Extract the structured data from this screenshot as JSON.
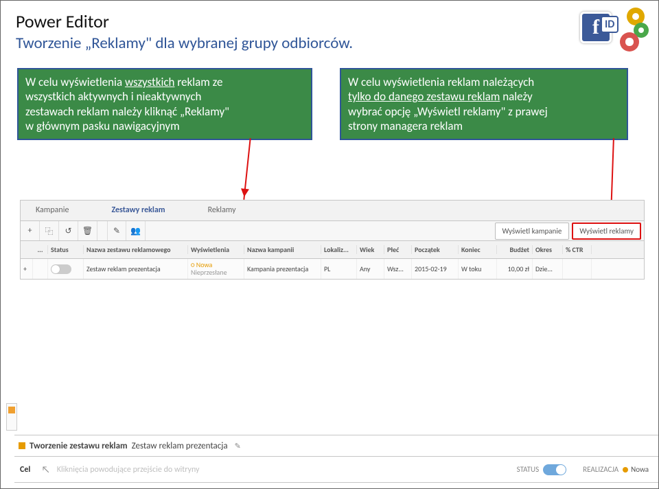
{
  "title": {
    "main": "Power Editor",
    "sub": "Tworzenie „Reklamy\" dla wybranej grupy odbiorców."
  },
  "callouts": {
    "left": {
      "line1a": "W celu wyświetlenia ",
      "line1b_underline": "wszystkich",
      "line1c": " reklam ze",
      "line2": "wszystkich aktywnych i nieaktywnych",
      "line3": "zestawach reklam należy kliknąć „Reklamy\"",
      "line4": "w głównym pasku nawigacyjnym"
    },
    "right": {
      "line1": "W celu wyświetlenia reklam należących",
      "line2a_underline": "tylko do danego zestawu reklam",
      "line2b": " należy",
      "line3": "wybrać opcję „Wyświetl reklamy\" z prawej",
      "line4": "strony managera reklam"
    }
  },
  "tabs": {
    "kampanie": "Kampanie",
    "zestawy": "Zestawy reklam",
    "reklamy": "Reklamy"
  },
  "right_buttons": {
    "campaigns": "Wyświetl kampanie",
    "ads": "Wyświetl reklamy"
  },
  "toolbar": {
    "add": "+",
    "dup": "⿻",
    "rev": "↺",
    "del": "🗑",
    "edit": "✎",
    "multi": "👥"
  },
  "headers": {
    "etc": "...",
    "status": "Status",
    "name": "Nazwa zestawu reklamowego",
    "wysw": "Wyświetlenia",
    "kamp": "Nazwa kampanii",
    "lok": "Lokaliz...",
    "wiek": "Wiek",
    "plec": "Płeć",
    "pocz": "Początek",
    "kon": "Koniec",
    "budz": "Budżet",
    "okres": "Okres",
    "ctr": "% CTR"
  },
  "row": {
    "expand": "+",
    "name": "Zestaw reklam prezentacja",
    "wysw_top": "○ Nowa",
    "wysw_sub": "Nieprzesłane",
    "kamp": "Kampania prezentacja",
    "lok": "PL",
    "wiek": "Any",
    "plec": "Wsz...",
    "pocz": "2015-02-19",
    "kon": "W toku",
    "budz": "10,00 zł",
    "okres": "Dzie..."
  },
  "bottom": {
    "title_bold": "Tworzenie zestawu reklam",
    "title_rest": "Zestaw reklam prezentacja",
    "edit_icon": "✎",
    "cel": "Cel",
    "hint": "Kliknięcia powodujące przejście do witryny",
    "status": "STATUS",
    "realizacja": "REALIZACJA",
    "nowa": "Nowa"
  }
}
